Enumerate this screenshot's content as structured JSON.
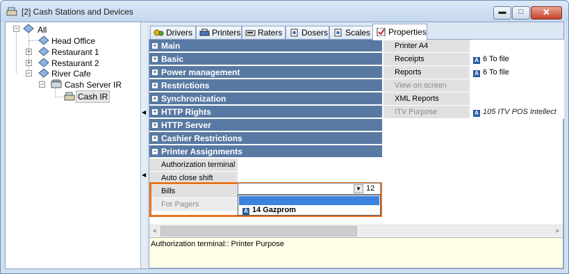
{
  "window": {
    "title": "[2] Cash Stations and Devices",
    "controls": {
      "minimize": "▬",
      "maximize": "□",
      "close": "✕"
    }
  },
  "tree": {
    "items": [
      {
        "label": "All"
      },
      {
        "label": "Head Office"
      },
      {
        "label": "Restaurant 1"
      },
      {
        "label": "Restaurant 2"
      },
      {
        "label": "River Cafe"
      },
      {
        "label": "Cash Server IR"
      },
      {
        "label": "Cash IR"
      }
    ]
  },
  "tabs": [
    {
      "label": "Drivers"
    },
    {
      "label": "Printers"
    },
    {
      "label": "Raters"
    },
    {
      "label": "Dosers"
    },
    {
      "label": "Scales"
    },
    {
      "label": "Properties"
    }
  ],
  "categories": [
    {
      "label": "Main"
    },
    {
      "label": "Basic"
    },
    {
      "label": "Power management"
    },
    {
      "label": "Restrictions"
    },
    {
      "label": "Synchronization"
    },
    {
      "label": "HTTP Rights"
    },
    {
      "label": "HTTP Server"
    },
    {
      "label": "Cashier Restrictions"
    },
    {
      "label": "Printer Assignments"
    }
  ],
  "printer_assignments": {
    "rows": [
      {
        "name": "Authorization terminal"
      },
      {
        "name": "Auto close shift"
      },
      {
        "name": "Bills"
      },
      {
        "name": "For Pagers"
      }
    ],
    "combo_number": "12",
    "dropdown_option": "14 Gazprom"
  },
  "right_props": [
    {
      "name": "Printer A4",
      "value": ""
    },
    {
      "name": "Receipts",
      "value": "6 To file"
    },
    {
      "name": "Reports",
      "value": "6 To file"
    },
    {
      "name": "View on screen",
      "value": ""
    },
    {
      "name": "XML Reports",
      "value": ""
    },
    {
      "name": "ITV Purpose",
      "value": "105 ITV POS Intellect"
    }
  ],
  "description": "Authorization terminal:: Printer Purpose",
  "colors": {
    "category_bg": "#5879a3",
    "highlight_border": "#e8741e",
    "selection": "#3c83e0",
    "description_bg": "#ffffe7"
  }
}
